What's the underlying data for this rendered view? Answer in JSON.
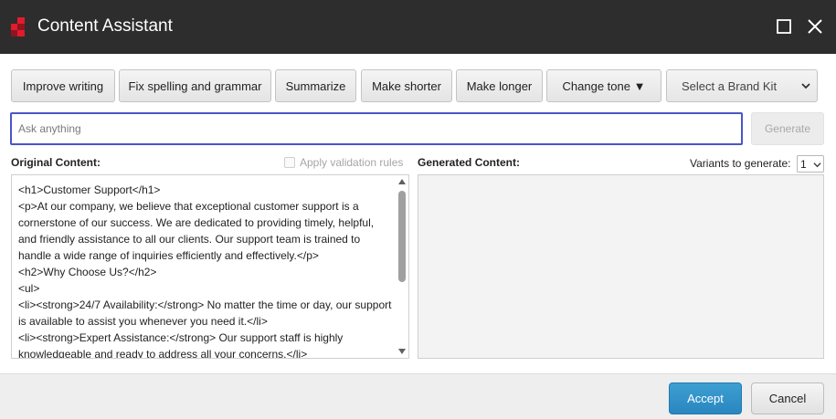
{
  "window": {
    "title": "Content Assistant",
    "titlebar_color": "#2d2d2d",
    "logo_colors": [
      "#e21b2d",
      "#8e1420"
    ]
  },
  "toolbar": {
    "improve_writing": "Improve writing",
    "fix_spelling": "Fix spelling and grammar",
    "summarize": "Summarize",
    "make_shorter": "Make shorter",
    "make_longer": "Make longer",
    "change_tone": "Change tone ▼",
    "brand_kit": {
      "selected": "Select a Brand Kit"
    }
  },
  "prompt": {
    "placeholder": "Ask anything",
    "value": "",
    "generate_label": "Generate"
  },
  "original": {
    "label": "Original Content:",
    "validation_label": "Apply validation rules",
    "validation_checked": false,
    "content": "<h1>Customer Support</h1>\n<p>At our company, we believe that exceptional customer support is a cornerstone of our success. We are dedicated to providing timely, helpful, and friendly assistance to all our clients. Our support team is trained to handle a wide range of inquiries efficiently and effectively.</p>\n<h2>Why Choose Us?</h2>\n<ul>\n<li><strong>24/7 Availability:</strong> No matter the time or day, our support is available to assist you whenever you need it.</li>\n<li><strong>Expert Assistance:</strong> Our support staff is highly knowledgeable and ready to address all your concerns.</li>"
  },
  "generated": {
    "label": "Generated Content:",
    "variants_label": "Variants to generate:",
    "variants_value": "1",
    "content": ""
  },
  "footer": {
    "accept_label": "Accept",
    "cancel_label": "Cancel",
    "accent_color": "#2a86bf"
  }
}
